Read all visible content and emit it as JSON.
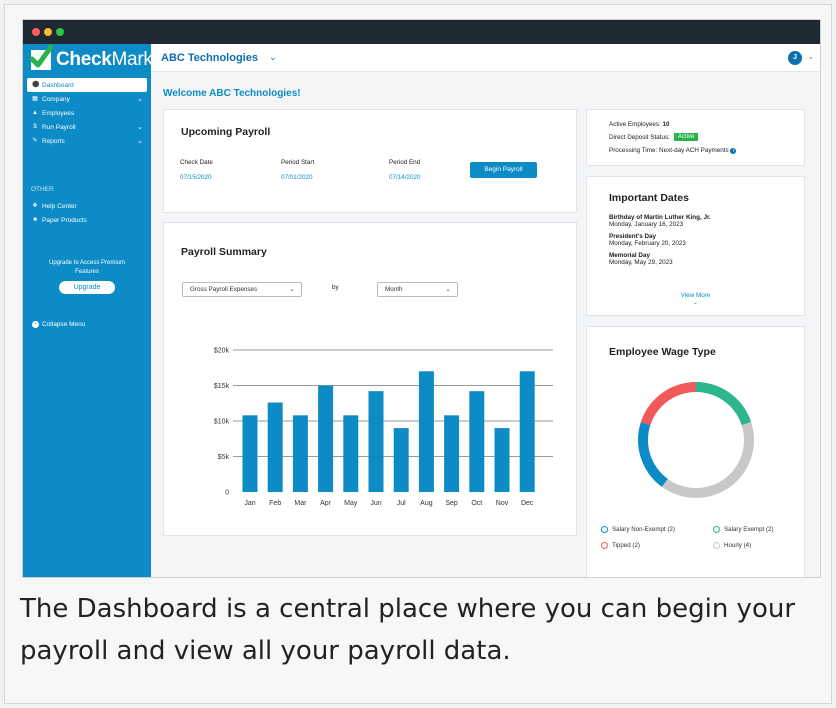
{
  "app": {
    "logo_text_bold": "Check",
    "logo_text_normal": "Mark",
    "company": "ABC Technologies",
    "avatar_initial": "J"
  },
  "sidebar": {
    "items": [
      {
        "label": "Dashboard",
        "icon": "dashboard-icon",
        "active": true
      },
      {
        "label": "Company",
        "icon": "building-icon",
        "chevron": true
      },
      {
        "label": "Employees",
        "icon": "person-icon"
      },
      {
        "label": "Run Payroll",
        "icon": "dollar-icon",
        "chevron": true
      },
      {
        "label": "Reports",
        "icon": "wrench-icon",
        "chevron": true
      }
    ],
    "other_heading": "OTHER",
    "other_items": [
      {
        "label": "Help Center",
        "icon": "help-icon"
      },
      {
        "label": "Paper Products",
        "icon": "document-icon"
      }
    ],
    "promo_text": "Upgrade to Access Premium Features",
    "upgrade_label": "Upgrade",
    "collapse_label": "Collapse Menu"
  },
  "welcome": "Welcome ABC Technologies!",
  "upcoming_payroll": {
    "title": "Upcoming Payroll",
    "check_date_label": "Check Date",
    "check_date": "07/15/2020",
    "period_start_label": "Period Start",
    "period_start": "07/01/2020",
    "period_end_label": "Period End",
    "period_end": "07/14/2020",
    "button_label": "Begin Payroll"
  },
  "status": {
    "active_employees_label": "Active Employees:",
    "active_employees": "10",
    "direct_deposit_label": "Direct Deposit Status:",
    "direct_deposit_badge": "Active",
    "processing_time": "Processing Time: Next-day ACH Payments"
  },
  "important_dates": {
    "title": "Important Dates",
    "items": [
      {
        "name": "Birthday of Martin Luther King, Jr.",
        "date": "Monday, January 16, 2023"
      },
      {
        "name": "President's Day",
        "date": "Monday, February 20, 2023"
      },
      {
        "name": "Memorial Day",
        "date": "Monday, May 29, 2023"
      }
    ],
    "view_more": "View More"
  },
  "payroll_summary": {
    "title": "Payroll Summary",
    "metric_select": "Gross Payroll Expenses",
    "by_label": "by",
    "period_select": "Month"
  },
  "chart_data": {
    "type": "bar",
    "categories": [
      "Jan",
      "Feb",
      "Mar",
      "Apr",
      "May",
      "Jun",
      "Jul",
      "Aug",
      "Sep",
      "Oct",
      "Nov",
      "Dec"
    ],
    "values": [
      10800,
      12600,
      10800,
      15000,
      10800,
      14200,
      9000,
      17000,
      10800,
      14200,
      9000,
      17000
    ],
    "ylim": [
      0,
      20000
    ],
    "yticks": [
      0,
      5000,
      10000,
      15000,
      20000
    ],
    "ytick_labels": [
      "0",
      "$5k",
      "$10k",
      "$15k",
      "$20k"
    ],
    "grid": true,
    "color": "#0d8bc6"
  },
  "wage_type": {
    "title": "Employee Wage Type",
    "chart_data": {
      "type": "pie",
      "categories": [
        "Salary Non-Exempt",
        "Tipped",
        "Salary Exempt",
        "Hourly"
      ],
      "values": [
        2,
        2,
        2,
        4
      ]
    },
    "legend": [
      {
        "label": "Salary Non-Exempt (2)",
        "color": "#0d8bc6"
      },
      {
        "label": "Salary Exempt (2)",
        "color": "#2bb68c"
      },
      {
        "label": "Tipped (2)",
        "color": "#f05a5a"
      },
      {
        "label": "Hourly (4)",
        "color": "#c8c8c8"
      }
    ]
  },
  "caption": "The Dashboard is a central place where you can begin your payroll and view all your payroll data."
}
